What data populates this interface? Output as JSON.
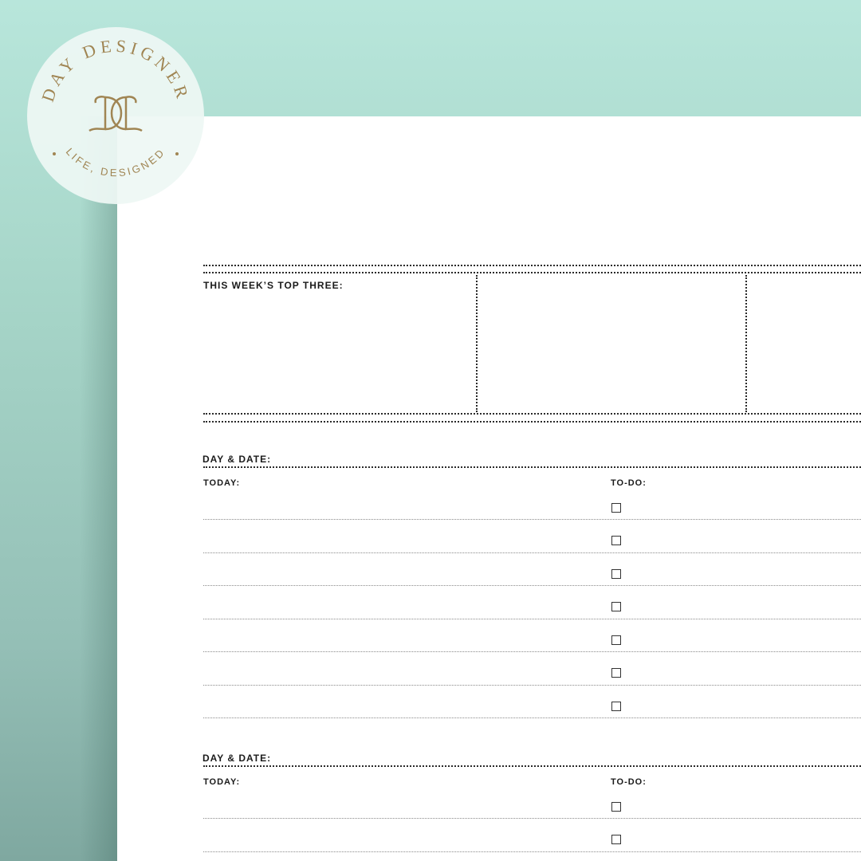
{
  "brand": {
    "name": "DAY DESIGNER",
    "tagline": "LIFE, DESIGNED",
    "accent_color": "#a08553"
  },
  "planner": {
    "top_three_label": "THIS WEEK’S TOP THREE:",
    "days": [
      {
        "day_date_label": "DAY & DATE:",
        "today_label": "TODAY:",
        "todo_label": "TO-DO:"
      },
      {
        "day_date_label": "DAY & DATE:",
        "today_label": "TODAY:",
        "todo_label": "TO-DO:"
      }
    ]
  },
  "icons": [
    "checkbox-icon",
    "monogram-icon"
  ]
}
